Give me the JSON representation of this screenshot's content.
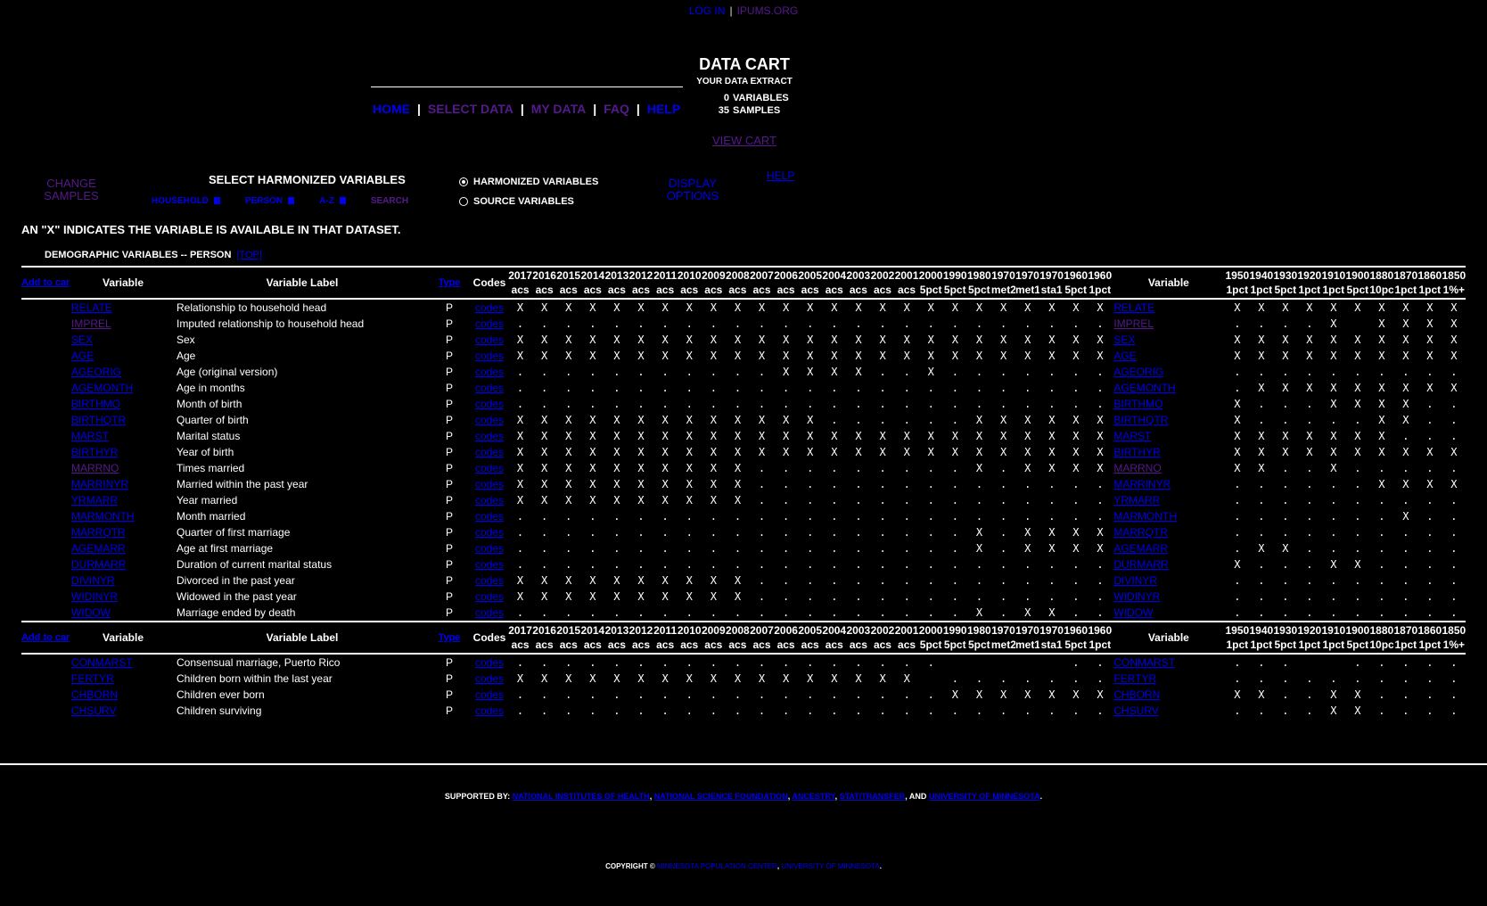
{
  "top_links": {
    "login": "LOG IN",
    "ipums": "IPUMS.ORG",
    "sep": "|"
  },
  "nav": {
    "home": "HOME",
    "select_data": "SELECT DATA",
    "my_data": "MY DATA",
    "faq": "FAQ",
    "help": "HELP",
    "sep": "|"
  },
  "cart": {
    "title": "DATA CART",
    "subtitle": "YOUR DATA EXTRACT",
    "variables_count": "0",
    "variables_label": "VARIABLES",
    "samples_count": "35",
    "samples_label": "SAMPLES",
    "view_cart": "VIEW CART"
  },
  "select": {
    "change_samples": "CHANGE SAMPLES",
    "heading": "SELECT HARMONIZED VARIABLES",
    "household": "HOUSEHOLD",
    "person": "PERSON",
    "az": "A-Z",
    "search": "SEARCH",
    "radio_harmonized": "HARMONIZED VARIABLES",
    "radio_source": "SOURCE VARIABLES",
    "display_options": "DISPLAY OPTIONS",
    "help": "HELP"
  },
  "note": "AN \"X\" INDICATES THE VARIABLE IS AVAILABLE IN THAT DATASET.",
  "section": {
    "title": "DEMOGRAPHIC VARIABLES -- PERSON",
    "top": "[TOP]"
  },
  "table": {
    "headers": {
      "add_to_cart": "Add to cart",
      "variable": "Variable",
      "label": "Variable Label",
      "type": "Type",
      "codes": "Codes",
      "codes_link": "codes"
    },
    "left_samples": [
      [
        "2017",
        "acs"
      ],
      [
        "2016",
        "acs"
      ],
      [
        "2015",
        "acs"
      ],
      [
        "2014",
        "acs"
      ],
      [
        "2013",
        "acs"
      ],
      [
        "2012",
        "acs"
      ],
      [
        "2011",
        "acs"
      ],
      [
        "2010",
        "acs"
      ],
      [
        "2009",
        "acs"
      ],
      [
        "2008",
        "acs"
      ],
      [
        "2007",
        "acs"
      ],
      [
        "2006",
        "acs"
      ],
      [
        "2005",
        "acs"
      ],
      [
        "2004",
        "acs"
      ],
      [
        "2003",
        "acs"
      ],
      [
        "2002",
        "acs"
      ],
      [
        "2001",
        "acs"
      ],
      [
        "2000",
        "5pct"
      ],
      [
        "1990",
        "5pct"
      ],
      [
        "1980",
        "5pct"
      ],
      [
        "1970",
        "met2"
      ],
      [
        "1970",
        "met1"
      ],
      [
        "1970",
        "sta1"
      ],
      [
        "1960",
        "5pct"
      ],
      [
        "1960",
        "1pct"
      ]
    ],
    "right_samples": [
      [
        "1950",
        "1pct"
      ],
      [
        "1940",
        "1pct"
      ],
      [
        "1930",
        "5pct"
      ],
      [
        "1920",
        "1pct"
      ],
      [
        "1910",
        "1pct"
      ],
      [
        "1900",
        "5pct"
      ],
      [
        "1880",
        "10pct"
      ],
      [
        "1870",
        "1pct"
      ],
      [
        "1860",
        "1pct"
      ],
      [
        "1850",
        "1%+"
      ]
    ],
    "groups": [
      [
        {
          "name": "RELATE",
          "label": "Relationship to household head",
          "type": "P",
          "visited": false,
          "left": "XXXXXXXXXXXXXXXXXXXXXXXXX",
          "right": "XXXXXXXXXX"
        },
        {
          "name": "IMPREL",
          "label": "Imputed relationship to household head",
          "type": "P",
          "visited": true,
          "left": ".........................",
          "right": "....X XXXX"
        },
        {
          "name": "SEX",
          "label": "Sex",
          "type": "P",
          "visited": false,
          "left": "XXXXXXXXXXXXXXXXXXXXXXXXX",
          "right": "XXXXXXXXXX"
        },
        {
          "name": "AGE",
          "label": "Age",
          "type": "P",
          "visited": false,
          "left": "XXXXXXXXXXXXXXXXXXXXXXXXX",
          "right": "XXXXXXXXXX"
        },
        {
          "name": "AGEORIG",
          "label": "Age (original version)",
          "type": "P",
          "visited": false,
          "left": "...........XXXX..X.......",
          "right": ".........."
        },
        {
          "name": "AGEMONTH",
          "label": "Age in months",
          "type": "P",
          "visited": false,
          "left": ".........................",
          "right": ".XXXXXXXXX"
        },
        {
          "name": "BIRTHMO",
          "label": "Month of birth",
          "type": "P",
          "visited": false,
          "left": ".........................",
          "right": "X...XXXX.."
        },
        {
          "name": "BIRTHQTR",
          "label": "Quarter of birth",
          "type": "P",
          "visited": false,
          "left": "XXXXXXXXXXXXX......XXXXXX",
          "right": "X.....XX.."
        },
        {
          "name": "MARST",
          "label": "Marital status",
          "type": "P",
          "visited": false,
          "left": "XXXXXXXXXXXXXXXXXXXXXXXXX",
          "right": "XXXXXXX..."
        },
        {
          "name": "BIRTHYR",
          "label": "Year of birth",
          "type": "P",
          "visited": false,
          "left": "XXXXXXXXXXXXXXXXXXXXXXXXX",
          "right": "XXXXXXXXXX"
        },
        {
          "name": "MARRNO",
          "label": "Times married",
          "type": "P",
          "visited": true,
          "left": "XXXXXXXXXX.........X.XXXX",
          "right": "XX..X....."
        },
        {
          "name": "MARRINYR",
          "label": "Married within the past year",
          "type": "P",
          "visited": false,
          "left": "XXXXXXXXXX...............",
          "right": "......XXXX"
        },
        {
          "name": "YRMARR",
          "label": "Year married",
          "type": "P",
          "visited": false,
          "left": "XXXXXXXXXX...............",
          "right": ".........."
        },
        {
          "name": "MARMONTH",
          "label": "Month married",
          "type": "P",
          "visited": false,
          "left": ".........................",
          "right": ".......X.."
        },
        {
          "name": "MARRQTR",
          "label": "Quarter of first marriage",
          "type": "P",
          "visited": false,
          "left": "...................X.XXXX",
          "right": ".........."
        },
        {
          "name": "AGEMARR",
          "label": "Age at first marriage",
          "type": "P",
          "visited": false,
          "left": "...................X.XXXX",
          "right": ".XX......."
        },
        {
          "name": "DURMARR",
          "label": "Duration of current marital status",
          "type": "P",
          "visited": false,
          "left": ".........................",
          "right": "X...XX...."
        },
        {
          "name": "DIVINYR",
          "label": "Divorced in the past year",
          "type": "P",
          "visited": false,
          "left": "XXXXXXXXXX...............",
          "right": ".........."
        },
        {
          "name": "WIDINYR",
          "label": "Widowed in the past year",
          "type": "P",
          "visited": false,
          "left": "XXXXXXXXXX...............",
          "right": ".........."
        },
        {
          "name": "WIDOW",
          "label": "Marriage ended by death",
          "type": "P",
          "visited": false,
          "left": "...................X.XX..",
          "right": ".........."
        }
      ],
      [
        {
          "name": "CONMARST",
          "label": "Consensual marriage, Puerto Rico",
          "type": "P",
          "visited": false,
          "left": "..................     ..",
          "right": "...  ....."
        },
        {
          "name": "FERTYR",
          "label": "Children born within the last year",
          "type": "P",
          "visited": false,
          "left": "XXXXXXXXXXXXXXXXX .......",
          "right": ".........."
        },
        {
          "name": "CHBORN",
          "label": "Children ever born",
          "type": "P",
          "visited": false,
          "left": "..................XXXXXXX",
          "right": "XX..XX...."
        },
        {
          "name": "CHSURV",
          "label": "Children surviving",
          "type": "P",
          "visited": false,
          "left": ".........................",
          "right": "....XX...."
        }
      ]
    ]
  },
  "footer": {
    "supported_by": "SUPPORTED BY:",
    "nih": "NATIONAL INSTITUTES OF HEALTH",
    "nsf": "NATIONAL SCIENCE FOUNDATION",
    "ancestry": "ANCESTRY",
    "stat": "STAT/TRANSFER",
    "and": ", AND",
    "umn": "UNIVERSITY OF MINNESOTA",
    "copyright": "COPYRIGHT ©",
    "mpc": "MINNESOTA POPULATION CENTER",
    "umn2": "UNIVERSITY OF MINNESOTA"
  }
}
